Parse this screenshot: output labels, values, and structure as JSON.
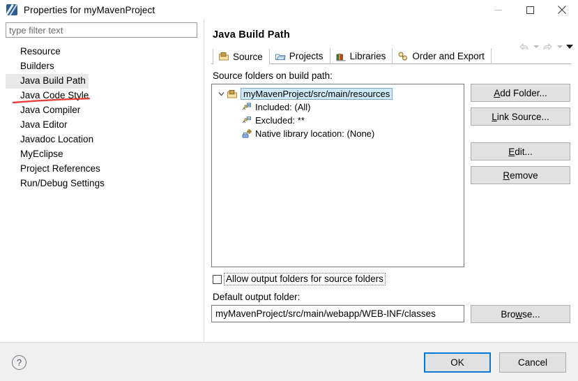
{
  "window": {
    "title": "Properties for myMavenProject",
    "icon": "eclipse-properties-icon",
    "minimize_label": "–",
    "maximize_label": "□",
    "close_label": "✕"
  },
  "sidebar": {
    "filter": {
      "placeholder": "type filter text",
      "value": ""
    },
    "items": [
      {
        "label": "Resource",
        "selected": false
      },
      {
        "label": "Builders",
        "selected": false
      },
      {
        "label": "Java Build Path",
        "selected": true
      },
      {
        "label": "Java Code Style",
        "selected": false
      },
      {
        "label": "Java Compiler",
        "selected": false
      },
      {
        "label": "Java Editor",
        "selected": false
      },
      {
        "label": "Javadoc Location",
        "selected": false
      },
      {
        "label": "MyEclipse",
        "selected": false
      },
      {
        "label": "Project References",
        "selected": false
      },
      {
        "label": "Run/Debug Settings",
        "selected": false
      }
    ],
    "annotation_color": "#e8413c"
  },
  "content": {
    "title": "Java Build Path",
    "nav": {
      "back_icon": "back-arrow-icon",
      "back_caret": "chevron-down-icon",
      "forward_icon": "forward-arrow-icon",
      "forward_caret": "chevron-down-icon",
      "menu_caret": "chevron-down-icon"
    },
    "tabs": [
      {
        "label": "Source",
        "icon": "source-folder-icon",
        "active": true
      },
      {
        "label": "Projects",
        "icon": "projects-folder-icon",
        "active": false
      },
      {
        "label": "Libraries",
        "icon": "libraries-books-icon",
        "active": false
      },
      {
        "label": "Order and Export",
        "icon": "order-export-icon",
        "active": false
      }
    ],
    "source_section_label": "Source folders on build path:",
    "tree": {
      "root": {
        "label": "myMavenProject/src/main/resources",
        "icon": "source-folder-icon",
        "expanded": true,
        "selected": true,
        "twisty": "chevron-down-icon"
      },
      "children": [
        {
          "label": "Included: (All)",
          "icon": "included-filter-icon"
        },
        {
          "label": "Excluded: **",
          "icon": "excluded-filter-icon"
        },
        {
          "label": "Native library location: (None)",
          "icon": "native-library-icon"
        }
      ]
    },
    "buttons": [
      {
        "name": "add-folder",
        "prefix": "A",
        "mnemonic": "",
        "label": "Add Folder...",
        "pre": "A",
        "mid": "dd Folder..."
      },
      {
        "name": "link-source",
        "label": "Link Source...",
        "pre": "L",
        "mid": "ink Source..."
      },
      {
        "name": "edit",
        "label": "Edit...",
        "pre": "E",
        "mid": "dit..."
      },
      {
        "name": "remove",
        "label": "Remove",
        "pre": "R",
        "mid": "emove"
      }
    ],
    "allow_output": {
      "label": "Allow output folders for source folders",
      "checked": false
    },
    "default_output_label": "Default output folder:",
    "default_output_value": "myMavenProject/src/main/webapp/WEB-INF/classes",
    "browse": {
      "pre": "Bro",
      "mn": "w",
      "post": "se..."
    }
  },
  "footer": {
    "help_label": "?",
    "ok_label": "OK",
    "cancel_label": "Cancel"
  }
}
